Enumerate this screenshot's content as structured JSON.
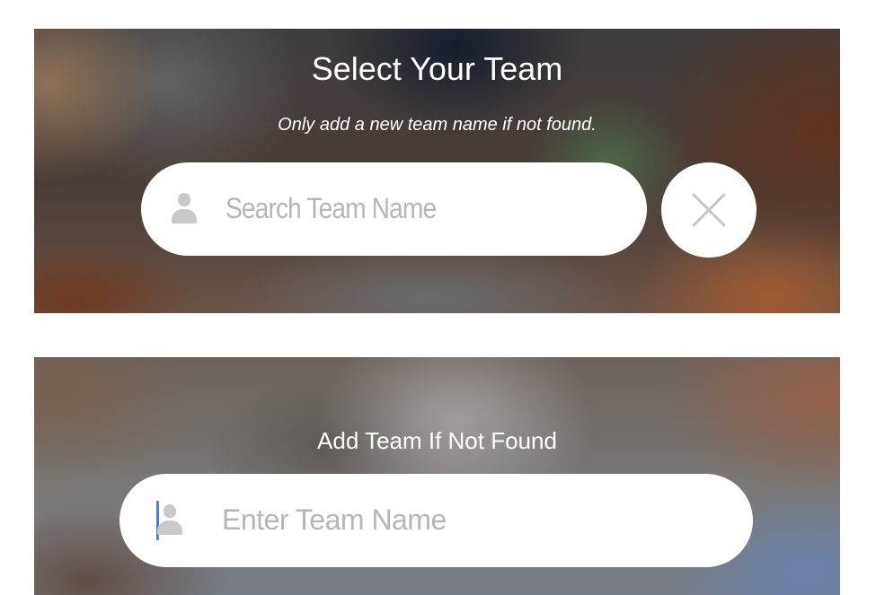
{
  "select_panel": {
    "title": "Select Your Team",
    "subtitle": "Only add a new team name if not found.",
    "search": {
      "placeholder": "Search Team Name",
      "icon": "user-icon"
    },
    "clear_icon": "close-icon"
  },
  "add_panel": {
    "title": "Add Team If Not Found",
    "input": {
      "placeholder": "Enter Team Name",
      "icon": "user-icon"
    }
  },
  "colors": {
    "pill_background": "#ffffff",
    "placeholder_text": "#b6b6b6",
    "icon_gray": "#c9c9c9",
    "caret_blue": "#4a7ee8",
    "close_x": "#c4c4c4"
  }
}
